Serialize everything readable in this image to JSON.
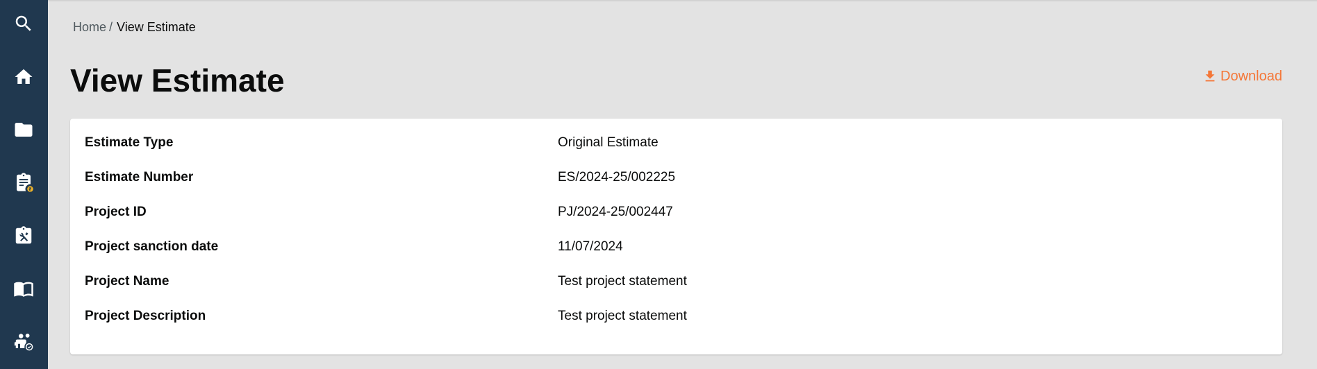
{
  "sidebar": {
    "icons": [
      "search-icon",
      "home-icon",
      "folder-icon",
      "clipboard-rupee-icon",
      "clipboard-tools-icon",
      "book-icon",
      "people-settings-icon"
    ]
  },
  "breadcrumb": {
    "home": "Home",
    "separator": "/",
    "current": "View Estimate"
  },
  "page": {
    "title": "View Estimate",
    "download_label": "Download"
  },
  "details": [
    {
      "label": "Estimate Type",
      "value": "Original Estimate"
    },
    {
      "label": "Estimate Number",
      "value": "ES/2024-25/002225"
    },
    {
      "label": "Project ID",
      "value": "PJ/2024-25/002447"
    },
    {
      "label": "Project sanction date",
      "value": "11/07/2024"
    },
    {
      "label": "Project Name",
      "value": "Test project statement"
    },
    {
      "label": "Project Description",
      "value": "Test project statement"
    }
  ],
  "colors": {
    "sidebar": "#20384f",
    "accent": "#f47738",
    "background": "#e3e3e3"
  }
}
